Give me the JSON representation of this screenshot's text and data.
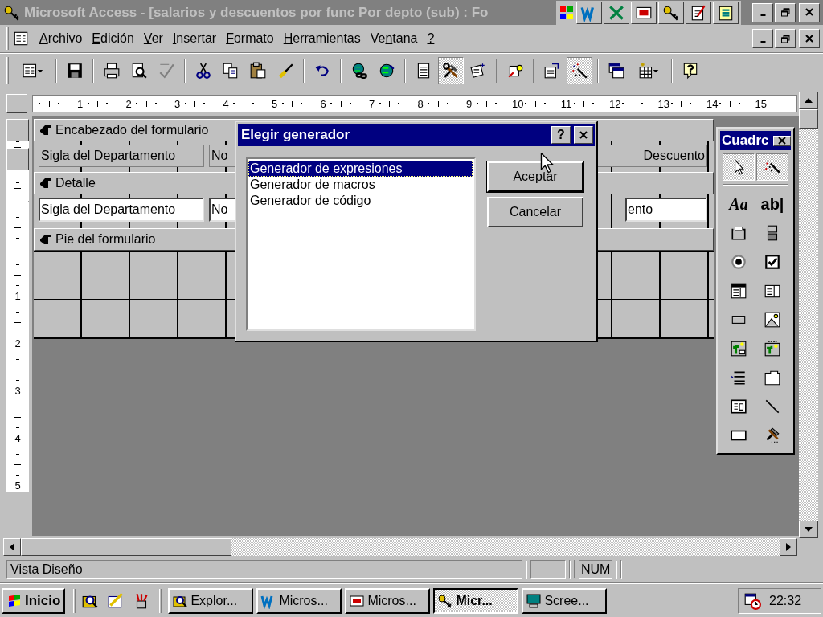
{
  "title_bar": {
    "title": "Microsoft Access - [salarios y descuentos por func Por depto (sub) : Fo",
    "office_bar": [
      {
        "kind": "office"
      },
      {
        "kind": "word"
      },
      {
        "kind": "excel"
      },
      {
        "kind": "powerpoint"
      },
      {
        "kind": "access"
      },
      {
        "kind": "notepad"
      },
      {
        "kind": "binder"
      }
    ]
  },
  "menu": [
    {
      "accel_key": "A",
      "rest": "rchivo"
    },
    {
      "accel_key": "E",
      "rest": "dición"
    },
    {
      "accel_key": "V",
      "rest": "er"
    },
    {
      "accel_key": "I",
      "rest": "nsertar"
    },
    {
      "accel_key": "F",
      "rest": "ormato"
    },
    {
      "accel_key": "H",
      "rest": "erramientas"
    },
    {
      "lead": "Ve",
      "accel_key": "n",
      "rest": "tana"
    },
    {
      "accel_key": "?"
    }
  ],
  "toolbar": [
    {
      "kind": "form-view-menu",
      "pressed": false
    },
    {
      "kind": "sep"
    },
    {
      "kind": "save",
      "pressed": false
    },
    {
      "kind": "sep"
    },
    {
      "kind": "print",
      "pressed": false
    },
    {
      "kind": "preview",
      "pressed": false
    },
    {
      "kind": "spelling",
      "pressed": false
    },
    {
      "kind": "sep"
    },
    {
      "kind": "cut",
      "pressed": false
    },
    {
      "kind": "copy",
      "pressed": false
    },
    {
      "kind": "paste",
      "pressed": false
    },
    {
      "kind": "brush",
      "pressed": false
    },
    {
      "kind": "sep"
    },
    {
      "kind": "undo",
      "pressed": false
    },
    {
      "kind": "sep"
    },
    {
      "kind": "globe-link",
      "pressed": false
    },
    {
      "kind": "globe",
      "pressed": false
    },
    {
      "kind": "sep"
    },
    {
      "kind": "field-list",
      "pressed": false
    },
    {
      "kind": "tools",
      "pressed": true
    },
    {
      "kind": "autoformat",
      "pressed": false
    },
    {
      "kind": "sep"
    },
    {
      "kind": "code",
      "pressed": false
    },
    {
      "kind": "sep"
    },
    {
      "kind": "properties",
      "pressed": false
    },
    {
      "kind": "wand",
      "pressed": true
    },
    {
      "kind": "sep"
    },
    {
      "kind": "database",
      "pressed": false
    },
    {
      "kind": "new-object-menu",
      "pressed": false
    },
    {
      "kind": "sep"
    },
    {
      "kind": "help",
      "pressed": false
    }
  ],
  "ruler": {
    "horizontal": [
      "1",
      "2",
      "3",
      "4",
      "5",
      "6",
      "7",
      "8",
      "9",
      "10",
      "11",
      "12",
      "13",
      "14",
      "15"
    ],
    "vertical": [
      "1",
      "2",
      "3",
      "4",
      "5"
    ]
  },
  "form": {
    "sections": [
      {
        "kind": "header",
        "title": "Encabezado del formulario",
        "controls": [
          {
            "kind": "label",
            "text": "Sigla del Departamento"
          },
          {
            "kind": "label",
            "text": "No"
          },
          {
            "kind": "label",
            "text": "Descuento"
          }
        ]
      },
      {
        "kind": "detail",
        "title": "Detalle",
        "controls": [
          {
            "kind": "textbox",
            "text": "Sigla del Departamento"
          },
          {
            "kind": "textbox",
            "text": "No"
          },
          {
            "kind": "textbox",
            "text": "ento"
          }
        ]
      },
      {
        "kind": "footer",
        "title": "Pie del formulario"
      }
    ]
  },
  "dialog": {
    "title": "Elegir generador",
    "help": "?",
    "items": [
      {
        "label": "Generador de expresiones",
        "selected": true
      },
      {
        "label": "Generador de macros",
        "selected": false
      },
      {
        "label": "Generador de código",
        "selected": false
      }
    ],
    "buttons": [
      "Aceptar",
      "Cancelar"
    ]
  },
  "toolbox": {
    "title": "Cuadrc",
    "tools": [
      {
        "kind": "select",
        "pressed": true
      },
      {
        "kind": "wizard",
        "pressed": true
      },
      {
        "kind": "label",
        "glyph": "Aa",
        "pressed": false
      },
      {
        "kind": "textbox",
        "glyph": "ab|",
        "pressed": false
      },
      {
        "kind": "option-group",
        "pressed": false
      },
      {
        "kind": "toggle",
        "pressed": false
      },
      {
        "kind": "option",
        "pressed": false
      },
      {
        "kind": "checkbox",
        "pressed": false
      },
      {
        "kind": "combo",
        "pressed": false
      },
      {
        "kind": "list",
        "pressed": false
      },
      {
        "kind": "command",
        "pressed": false
      },
      {
        "kind": "image",
        "pressed": false
      },
      {
        "kind": "unbound-object",
        "pressed": false
      },
      {
        "kind": "bound-object",
        "pressed": false
      },
      {
        "kind": "page-break",
        "pressed": false
      },
      {
        "kind": "tab",
        "pressed": false
      },
      {
        "kind": "subform",
        "pressed": false
      },
      {
        "kind": "line",
        "pressed": false
      },
      {
        "kind": "rectangle",
        "pressed": false
      },
      {
        "kind": "more",
        "pressed": false
      }
    ]
  },
  "status_bar": {
    "text": "Vista Diseño",
    "indicators": [
      "NUM"
    ]
  },
  "taskbar": {
    "start": "Inicio",
    "quick_launch": [
      {
        "kind": "explorer"
      },
      {
        "kind": "desktop"
      },
      {
        "kind": "channels"
      }
    ],
    "buttons": [
      {
        "kind": "explorer",
        "label": "Explor...",
        "selected": false
      },
      {
        "kind": "word",
        "label": "Micros...",
        "selected": false
      },
      {
        "kind": "powerpoint",
        "label": "Micros...",
        "selected": false
      },
      {
        "kind": "access",
        "label": "Micr...",
        "selected": true
      },
      {
        "kind": "monitor",
        "label": "Scree...",
        "selected": false
      }
    ],
    "clock": "22:32"
  }
}
